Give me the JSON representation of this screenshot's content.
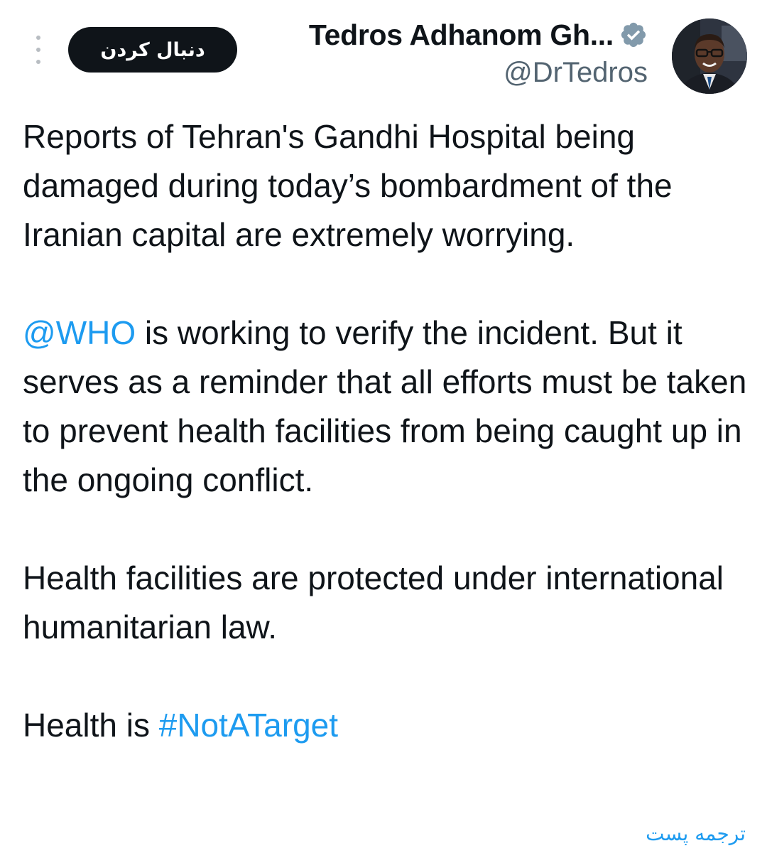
{
  "header": {
    "follow_label": "دنبال کردن",
    "display_name": "Tedros Adhanom Gh...",
    "handle": "@DrTedros",
    "icons": {
      "more": "more-vertical-icon",
      "verified": "verified-badge-icon"
    }
  },
  "tweet": {
    "p1": "Reports of Tehran's Gandhi Hospital being damaged during today’s bombardment of the Iranian capital are extremely worrying.",
    "p2_mention": "@WHO",
    "p2_rest": " is working to verify the incident. But it serves as a reminder that all efforts must be taken to prevent health facilities from being caught up in the ongoing conflict.",
    "p3": "Health facilities are protected under international humanitarian law.",
    "p4_prefix": "Health is ",
    "p4_hashtag": "#NotATarget"
  },
  "translate_label": "ترجمه پست",
  "colors": {
    "link": "#1d9bf0",
    "text": "#0f1419",
    "secondary": "#536471",
    "verified_badge": "#829aab"
  }
}
